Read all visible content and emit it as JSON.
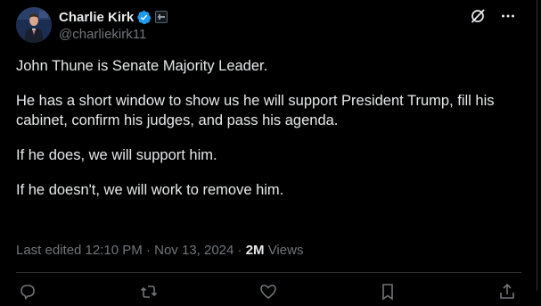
{
  "author": {
    "display_name": "Charlie Kirk",
    "handle": "@charliekirk11",
    "verified_color": "#1d9bf0"
  },
  "icons": {
    "avatar": "avatar-photo",
    "verified": "verified-badge-icon",
    "affiliation": "affiliate-badge-icon",
    "grok": "grok-icon",
    "more": "more-options-icon"
  },
  "tweet": {
    "paragraphs": [
      "John Thune is Senate Majority Leader.",
      "He has a short window to show us he will support President Trump, fill his cabinet, confirm his judges, and pass his agenda.",
      "If he does, we will support him.",
      "If he doesn't, we will work to remove him."
    ]
  },
  "meta": {
    "edited_label": "Last edited 12:10 PM",
    "separator": " · ",
    "date": "Nov 13, 2024",
    "views_count": "2M",
    "views_label": " Views"
  },
  "actions": [
    "reply-icon",
    "repost-icon",
    "like-icon",
    "bookmark-icon",
    "share-icon"
  ],
  "colors": {
    "background": "#000000",
    "text": "#e7e9ea",
    "muted": "#71767b",
    "border": "#2f3336"
  }
}
